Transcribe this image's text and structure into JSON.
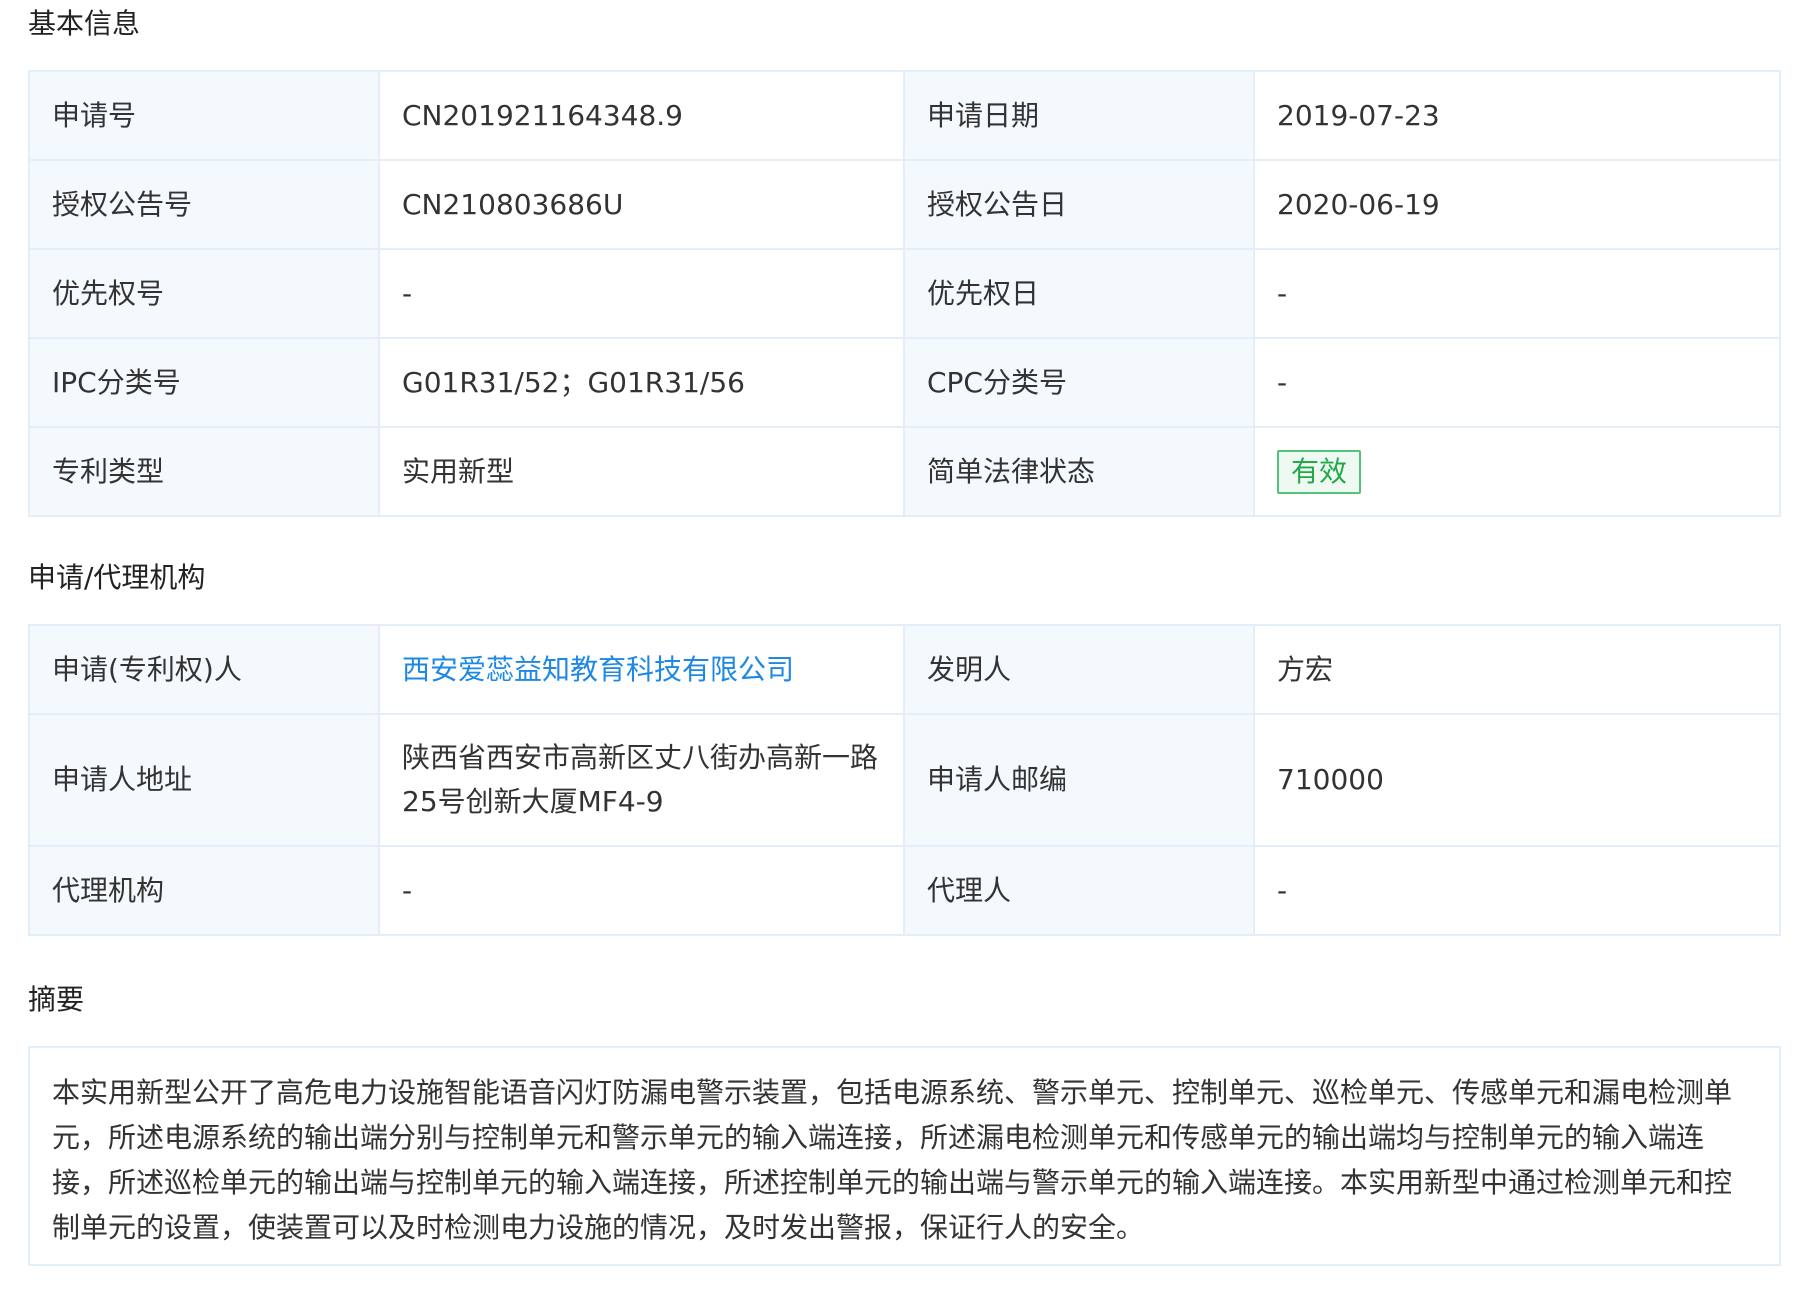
{
  "basic_info": {
    "title": "基本信息",
    "rows": [
      {
        "label_a": "申请号",
        "value_a": "CN201921164348.9",
        "label_b": "申请日期",
        "value_b": "2019-07-23"
      },
      {
        "label_a": "授权公告号",
        "value_a": "CN210803686U",
        "label_b": "授权公告日",
        "value_b": "2020-06-19"
      },
      {
        "label_a": "优先权号",
        "value_a": "-",
        "label_b": "优先权日",
        "value_b": "-"
      },
      {
        "label_a": "IPC分类号",
        "value_a": "G01R31/52；G01R31/56",
        "label_b": "CPC分类号",
        "value_b": "-"
      },
      {
        "label_a": "专利类型",
        "value_a": "实用新型",
        "label_b": "简单法律状态",
        "value_b": "有效"
      }
    ]
  },
  "agency": {
    "title": "申请/代理机构",
    "rows": [
      {
        "label_a": "申请(专利权)人",
        "value_a": "西安爱蕊益知教育科技有限公司",
        "label_b": "发明人",
        "value_b": "方宏"
      },
      {
        "label_a": "申请人地址",
        "value_a_line1": "陕西省西安市高新区丈八街办高新一路",
        "value_a_line2": "25号创新大厦MF4-9",
        "label_b": "申请人邮编",
        "value_b": "710000"
      },
      {
        "label_a": "代理机构",
        "value_a": "-",
        "label_b": "代理人",
        "value_b": "-"
      }
    ]
  },
  "abstract": {
    "title": "摘要",
    "text": "本实用新型公开了高危电力设施智能语音闪灯防漏电警示装置，包括电源系统、警示单元、控制单元、巡检单元、传感单元和漏电检测单元，所述电源系统的输出端分别与控制单元和警示单元的输入端连接，所述漏电检测单元和传感单元的输出端均与控制单元的输入端连接，所述巡检单元的输出端与控制单元的输入端连接，所述控制单元的输出端与警示单元的输入端连接。本实用新型中通过检测单元和控制单元的设置，使装置可以及时检测电力设施的情况，及时发出警报，保证行人的安全。"
  },
  "colors": {
    "link": "#1e88e5",
    "status_valid": "#22a94a",
    "label_bg": "#f4f9fd",
    "border": "#e3eef8"
  }
}
